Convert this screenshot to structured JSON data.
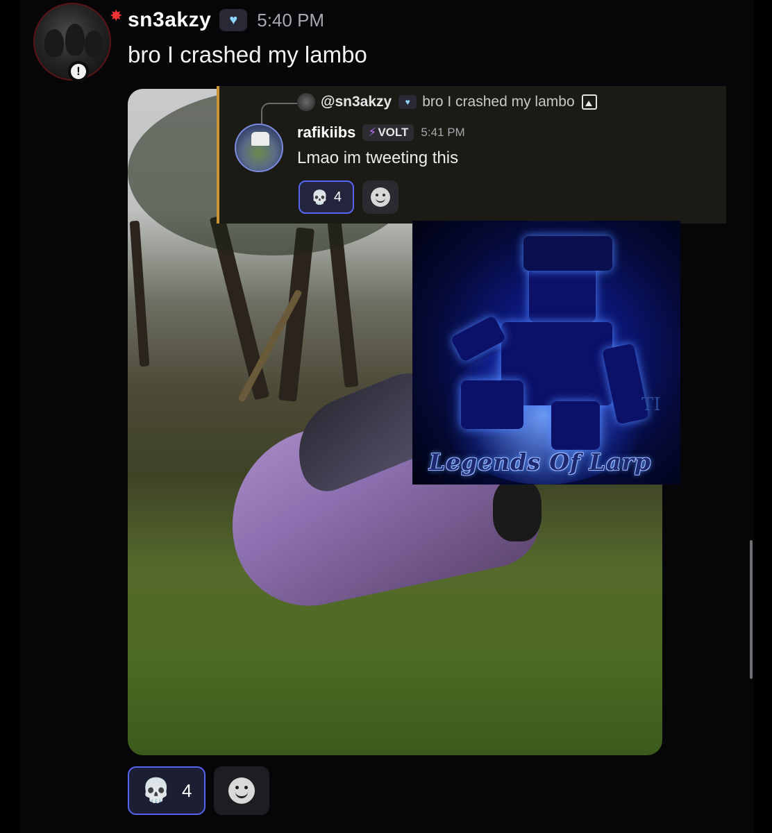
{
  "message": {
    "username": "sn3akzy",
    "timestamp": "5:40 PM",
    "text": "bro I crashed my lambo"
  },
  "reply_screenshot": {
    "quoted_user": "@sn3akzy",
    "quoted_text": "bro I crashed my lambo",
    "username": "rafikiibs",
    "role_tag": "VOLT",
    "timestamp": "5:41 PM",
    "text": "Lmao im tweeting this",
    "reaction_emoji": "💀",
    "reaction_count": "4"
  },
  "thumbnail": {
    "title": "Legends Of Larp",
    "watermark": "TI"
  },
  "reactions": {
    "emoji": "💀",
    "count": "4"
  },
  "colors": {
    "background": "#060608",
    "reaction_border": "#5865f2",
    "reply_accent": "#c89532",
    "role_bolt": "#b56ff0"
  },
  "icons": {
    "status_badge": "alert-icon",
    "name_badge": "heart-icon",
    "add_reaction": "smile-icon",
    "attachment_icon": "image-icon"
  }
}
